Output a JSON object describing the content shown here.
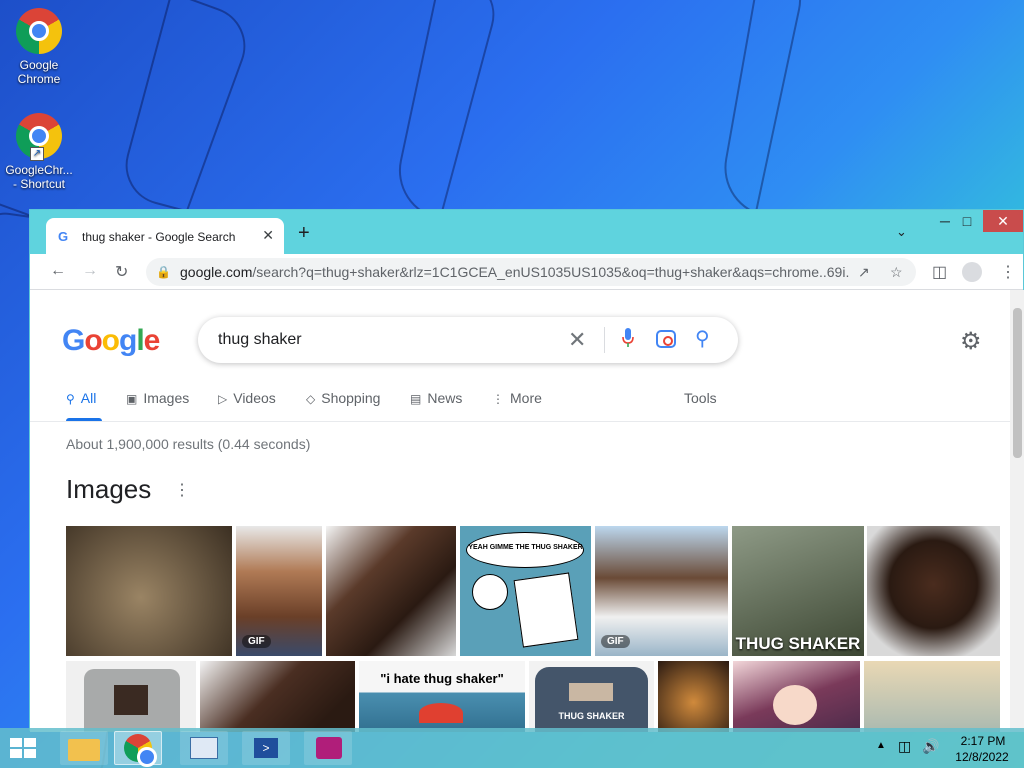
{
  "desktop": {
    "icons": [
      {
        "label": "Google\nChrome",
        "line1": "Google",
        "line2": "Chrome"
      },
      {
        "line1": "GoogleChr...",
        "line2": "- Shortcut"
      }
    ]
  },
  "browser": {
    "tab_title": "thug shaker - Google Search",
    "tab_favicon": "G",
    "new_tab_symbol": "+",
    "tab_search_icon": "⌄",
    "window_controls": {
      "minimize": "─",
      "maximize": "□",
      "close": "✕"
    },
    "url_host": "google.com",
    "url_path": "/search?q=thug+shaker&rlz=1C1GCEA_enUS1035US1035&oq=thug+shaker&aqs=chrome..69i..."
  },
  "google": {
    "logo_letters": [
      "G",
      "o",
      "o",
      "g",
      "l",
      "e"
    ],
    "logo_colors": [
      "#4285f4",
      "#ea4335",
      "#fbbc05",
      "#4285f4",
      "#34a853",
      "#ea4335"
    ],
    "query": "thug shaker",
    "tabs": [
      {
        "label": "All",
        "icon": "search-icon"
      },
      {
        "label": "Images",
        "icon": "image-icon"
      },
      {
        "label": "Videos",
        "icon": "play-icon"
      },
      {
        "label": "Shopping",
        "icon": "tag-icon"
      },
      {
        "label": "News",
        "icon": "news-icon"
      },
      {
        "label": "More",
        "icon": "more-vert-icon"
      }
    ],
    "tools_label": "Tools",
    "stats": "About 1,900,000 results (0.44 seconds)",
    "images_heading": "Images",
    "image_labels": {
      "gif": "GIF",
      "thug_shaker_caption": "THUG SHAKER",
      "comic_bubble": "YEAH GIMME THE THUG SHAKER",
      "hate_caption": "\"i hate thug shaker\"",
      "shirt_text": "THUG SHAKER"
    }
  },
  "taskbar": {
    "time": "2:17 PM",
    "date": "12/8/2022",
    "tray_up": "▲"
  },
  "colors": {
    "accent": "#1a73e8",
    "chrome_frame": "#5fd3de",
    "taskbar": "#64becd"
  }
}
